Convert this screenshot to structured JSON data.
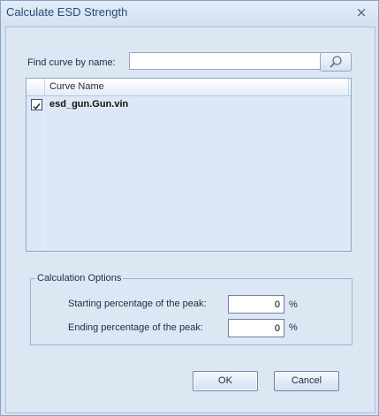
{
  "window": {
    "title": "Calculate ESD Strength",
    "close_symbol": "×"
  },
  "find": {
    "label": "Find curve by name:",
    "value": "",
    "placeholder": "",
    "search_icon": "search-icon"
  },
  "curve_list": {
    "column_header": "Curve Name",
    "rows": [
      {
        "name": "esd_gun.Gun.vin",
        "checked": true
      }
    ]
  },
  "calc_options": {
    "title": "Calculation Options",
    "start_label": "Starting percentage of the peak:",
    "start_value": "0",
    "end_label": "Ending percentage of the peak:",
    "end_value": "0",
    "unit": "%"
  },
  "buttons": {
    "ok_label": "OK",
    "cancel_label": "Cancel"
  }
}
